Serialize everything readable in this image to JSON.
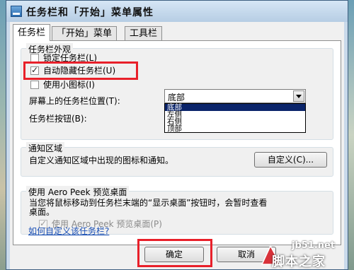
{
  "window": {
    "title": "任务栏和「开始」菜单属性"
  },
  "tabs": [
    {
      "label": "任务栏",
      "active": true
    },
    {
      "label": "「开始」菜单",
      "active": false
    },
    {
      "label": "工具栏",
      "active": false
    }
  ],
  "appearance": {
    "group_label": "任务栏外观",
    "lock_label": "锁定任务栏(L)",
    "lock_checked": false,
    "autohide_label": "自动隐藏任务栏(U)",
    "autohide_checked": true,
    "small_icons_label": "使用小图标(I)",
    "small_icons_checked": false,
    "position_label": "屏幕上的任务栏位置(T):",
    "position_value": "底部",
    "position_options": [
      "底部",
      "左侧",
      "右侧",
      "顶部"
    ],
    "buttons_label": "任务栏按钮(B):"
  },
  "notification": {
    "group_label": "通知区域",
    "description": "自定义通知区域中出现的图标和通知。",
    "customize_button": "自定义(C)..."
  },
  "aero_peek": {
    "group_label": "使用 Aero Peek 预览桌面",
    "description_line1": "当您将鼠标移动到任务栏末端的“显示桌面”按钮时，会暂时查看",
    "description_line2": "桌面。",
    "checkbox_label": "使用 Aero Peek 预览桌面(P)",
    "checkbox_checked": true,
    "checkbox_enabled": false
  },
  "help_link": "如何自定义该任务栏?",
  "footer": {
    "ok_label": "确定",
    "cancel_label": "取消"
  },
  "watermark": {
    "site": "jb51.net",
    "name": "脚本之家"
  },
  "colors": {
    "highlight_box": "#e8202a",
    "selection": "#0a246a",
    "link": "#1a4fb5"
  }
}
